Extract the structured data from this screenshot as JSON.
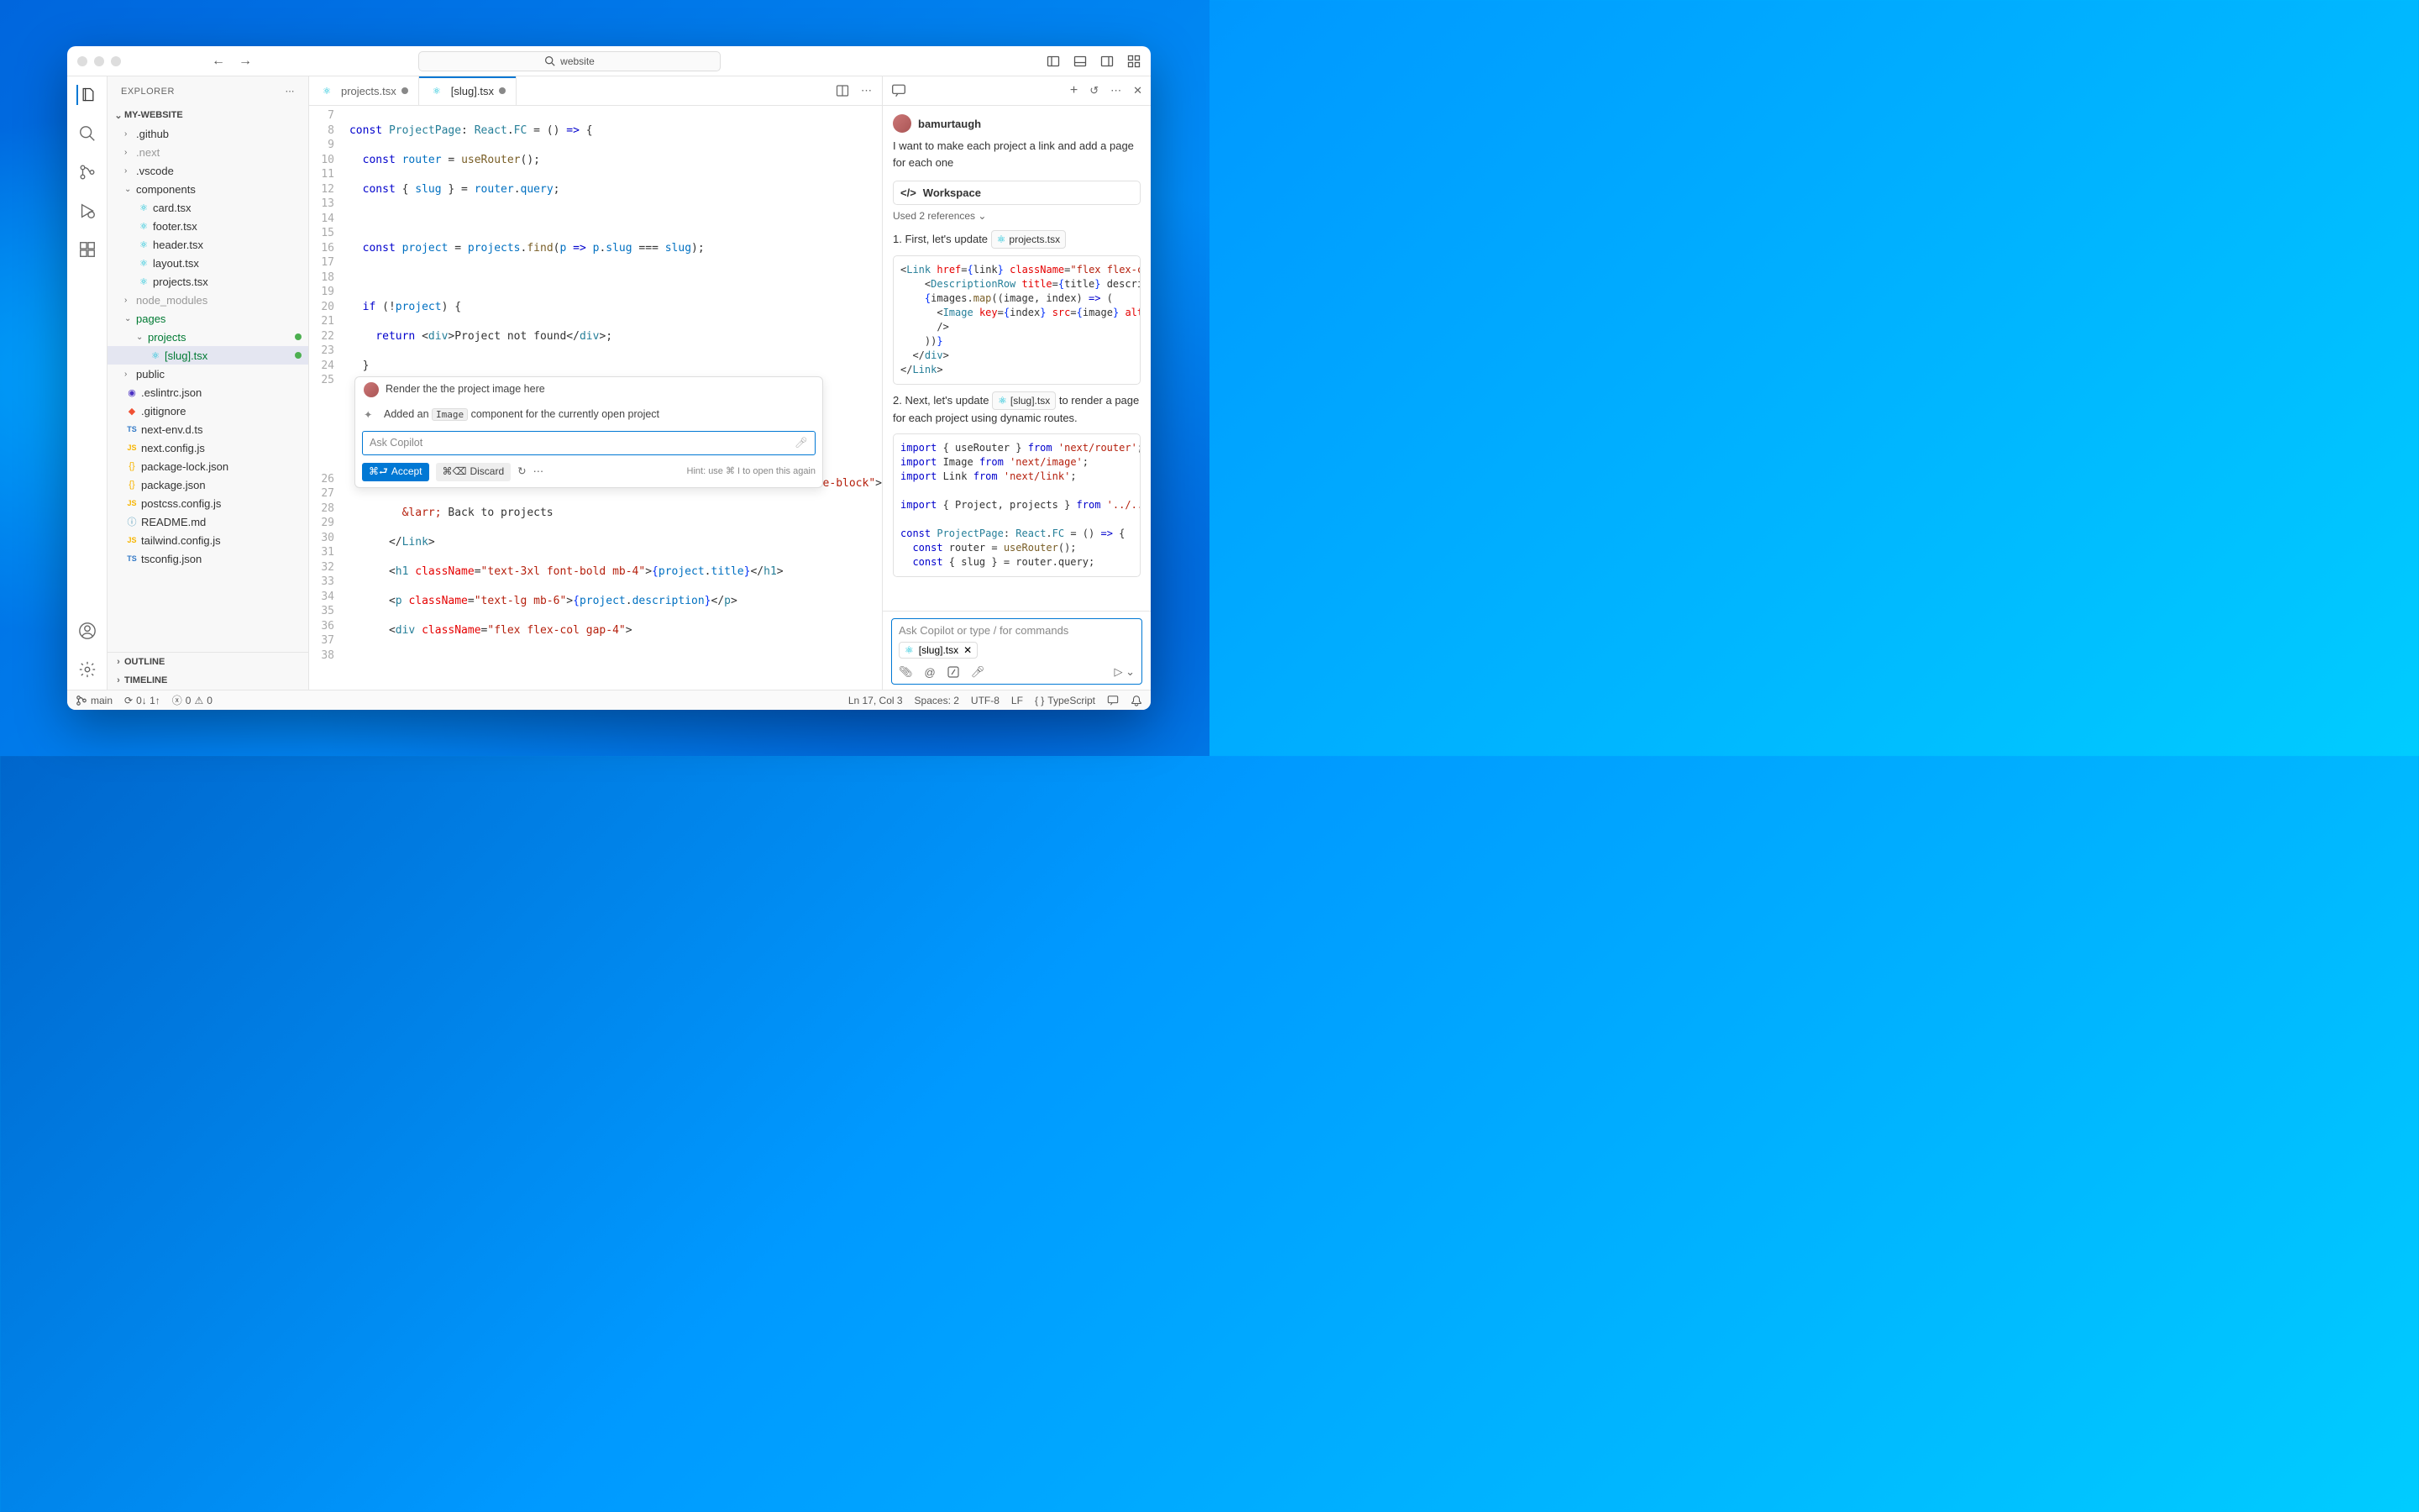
{
  "titlebar": {
    "search_text": "website"
  },
  "sidebar": {
    "title": "EXPLORER",
    "workspace": "MY-WEBSITE",
    "outline": "OUTLINE",
    "timeline": "TIMELINE",
    "tree": {
      "github": ".github",
      "next": ".next",
      "vscode": ".vscode",
      "components": "components",
      "card": "card.tsx",
      "footer": "footer.tsx",
      "header": "header.tsx",
      "layout": "layout.tsx",
      "projects_tsx": "projects.tsx",
      "node_modules": "node_modules",
      "pages": "pages",
      "projects_folder": "projects",
      "slug": "[slug].tsx",
      "public": "public",
      "eslint": ".eslintrc.json",
      "gitignore": ".gitignore",
      "nextenv": "next-env.d.ts",
      "nextconfig": "next.config.js",
      "pkglock": "package-lock.json",
      "pkg": "package.json",
      "postcss": "postcss.config.js",
      "readme": "README.md",
      "tailwind": "tailwind.config.js",
      "tsconfig": "tsconfig.json"
    }
  },
  "tabs": {
    "projects": "projects.tsx",
    "slug": "[slug].tsx"
  },
  "inline_chat": {
    "user_prompt": "Render the the project image here",
    "response_prefix": "Added an ",
    "response_code": "Image",
    "response_suffix": " component for the currently open project",
    "placeholder": "Ask Copilot",
    "accept_shortcut": "⌘⮐",
    "accept": "Accept",
    "discard_shortcut": "⌘⌫",
    "discard": "Discard",
    "hint": "Hint: use ⌘ I to open this again"
  },
  "chat": {
    "username": "bamurtaugh",
    "user_msg": "I want to make each project a link and add a page for each one",
    "workspace": "Workspace",
    "used_refs": "Used 2 references",
    "step1_prefix": "1. First, let's update ",
    "step1_pill": "projects.tsx",
    "step2_prefix": "2. Next, let's update ",
    "step2_pill": "[slug].tsx",
    "step2_suffix": " to render a page for each project using dynamic routes.",
    "input_placeholder": "Ask Copilot or type / for commands",
    "context_pill": "[slug].tsx"
  },
  "statusbar": {
    "branch": "main",
    "sync": "0↓ 1↑",
    "errors": "0",
    "warnings": "0",
    "cursor": "Ln 17, Col 3",
    "spaces": "Spaces: 2",
    "encoding": "UTF-8",
    "eol": "LF",
    "lang": "TypeScript"
  }
}
